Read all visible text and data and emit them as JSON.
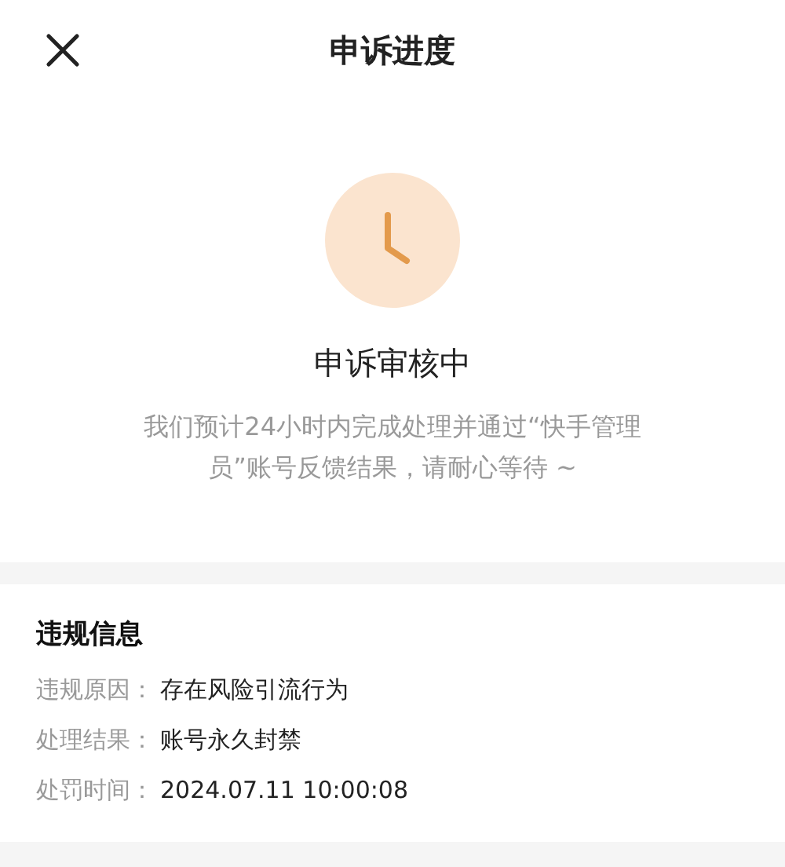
{
  "header": {
    "title": "申诉进度"
  },
  "status": {
    "title": "申诉审核中",
    "description": "我们预计24小时内完成处理并通过“快手管理员”账号反馈结果，请耐心等待 ~"
  },
  "info": {
    "title": "违规信息",
    "rows": [
      {
        "label": "违规原因：",
        "value": "存在风险引流行为"
      },
      {
        "label": "处理结果：",
        "value": "账号永久封禁"
      },
      {
        "label": "处罚时间：",
        "value": "2024.07.11 10:00:08"
      }
    ]
  }
}
